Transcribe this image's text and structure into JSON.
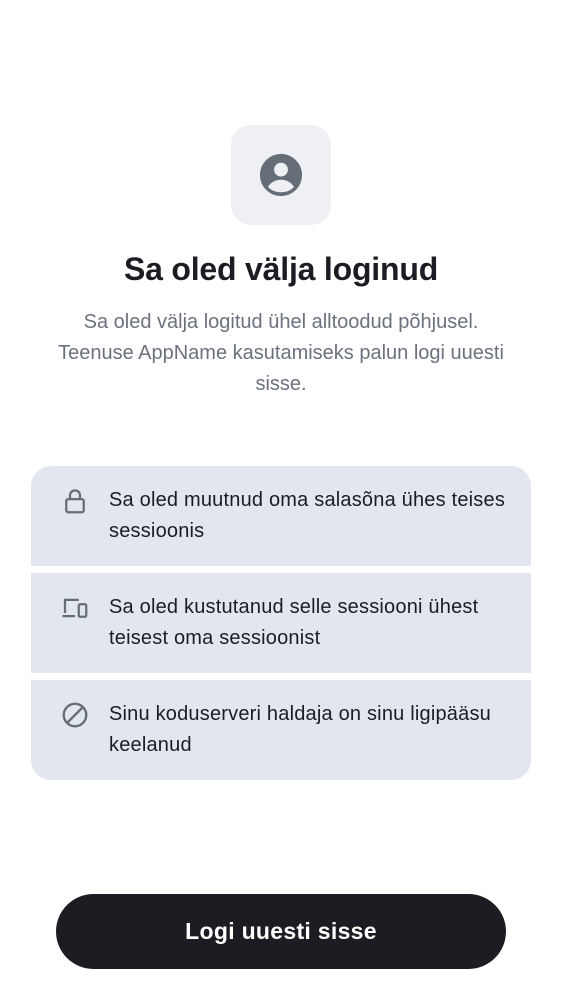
{
  "header": {
    "icon": "user-avatar-icon",
    "title": "Sa oled välja loginud",
    "subtitle": "Sa oled välja logitud ühel alltoodud põhjusel. Teenuse AppName kasutamiseks palun logi uuesti sisse."
  },
  "reasons": [
    {
      "icon": "lock-icon",
      "text": "Sa oled muutnud oma salasõna ühes teises sessioonis"
    },
    {
      "icon": "devices-icon",
      "text": "Sa oled kustutanud selle sessiooni ühest teisest oma sessioonist"
    },
    {
      "icon": "blocked-icon",
      "text": "Sinu koduserveri haldaja on sinu ligipääsu keelanud"
    }
  ],
  "actions": {
    "sign_in_again_label": "Logi uuesti sisse"
  },
  "colors": {
    "background": "#ffffff",
    "icon_tile": "#eef0f4",
    "reason_card": "#e2e6ef",
    "primary_button": "#1b1d22",
    "subtitle_text": "#6b717d",
    "icon_gray": "#656d77"
  }
}
